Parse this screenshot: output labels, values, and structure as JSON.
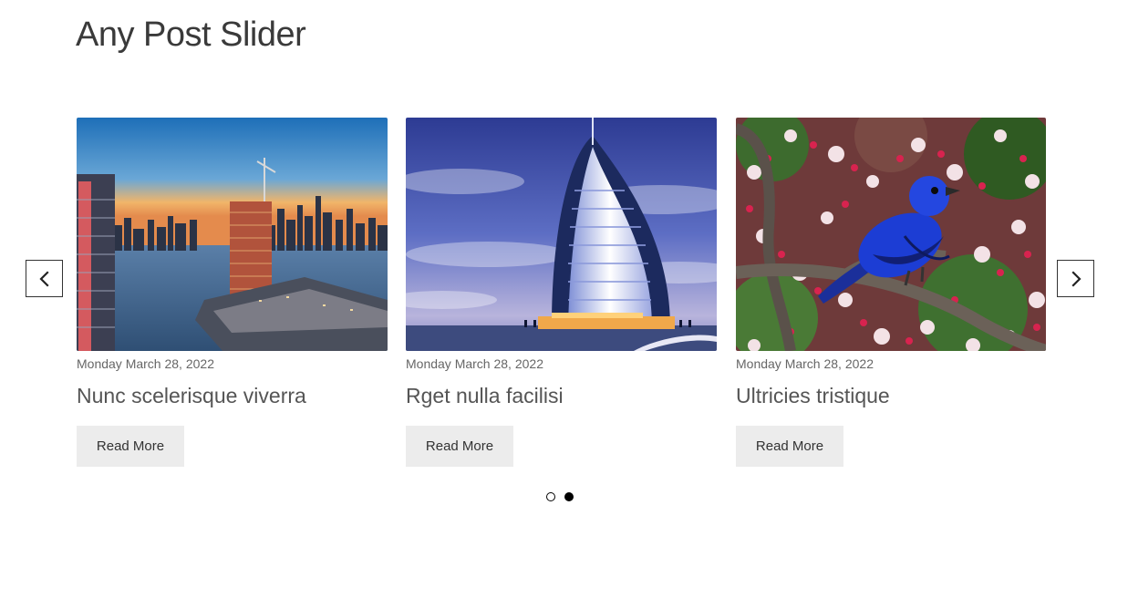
{
  "slider": {
    "title": "Any Post Slider",
    "prev_icon": "chevron-left-icon",
    "next_icon": "chevron-right-icon",
    "posts": [
      {
        "date": "Monday March 28, 2022",
        "title": "Nunc scelerisque viverra",
        "button_label": "Read More",
        "image": "city-waterfront-sunset"
      },
      {
        "date": "Monday March 28, 2022",
        "title": "Rget nulla facilisi",
        "button_label": "Read More",
        "image": "sail-shaped-tower-hotel"
      },
      {
        "date": "Monday March 28, 2022",
        "title": "Ultricies tristique",
        "button_label": "Read More",
        "image": "blue-bird-on-blossom-branch"
      }
    ],
    "pagination": {
      "pages": 2,
      "active_page": 2
    }
  },
  "colors": {
    "button_bg": "#ececec",
    "arrow_border": "#333333",
    "dot_active": "#000000"
  }
}
